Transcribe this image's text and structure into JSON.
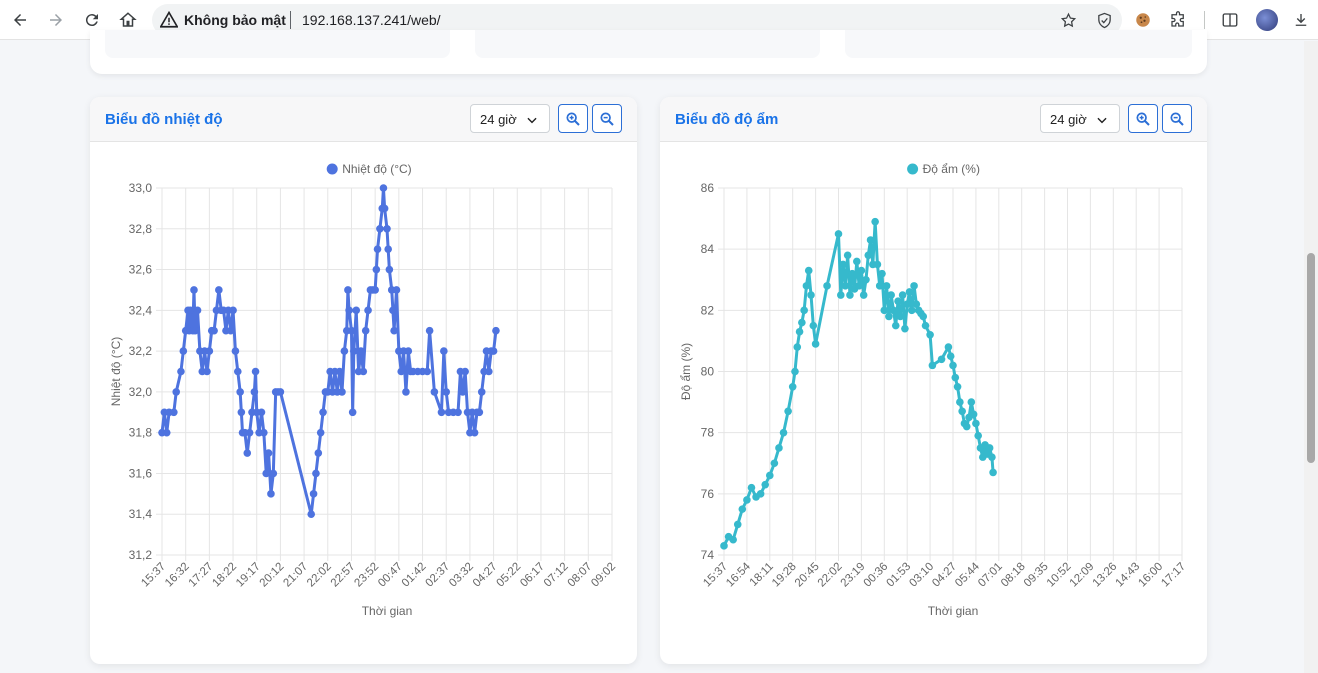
{
  "browser": {
    "security_label": "Không bảo mật",
    "url": "192.168.137.241/web/"
  },
  "cards": [
    {
      "title": "Biểu đồ nhiệt độ",
      "range_label": "24 giờ",
      "color": "#4e73df"
    },
    {
      "title": "Biểu đồ độ ẩm",
      "range_label": "24 giờ",
      "color": "#36b9cc"
    }
  ],
  "chart_data": [
    {
      "type": "line",
      "legend": "Nhiệt độ (°C)",
      "xlabel": "Thời gian",
      "ylabel": "Nhiệt độ (°C)",
      "ylim": [
        31.2,
        33.0
      ],
      "yticks": [
        "31,2",
        "31,4",
        "31,6",
        "31,8",
        "32,0",
        "32,2",
        "32,4",
        "32,6",
        "32,8",
        "33,0"
      ],
      "xticks": [
        "15:37",
        "16:32",
        "17:27",
        "18:22",
        "19:17",
        "20:12",
        "21:07",
        "22:02",
        "22:57",
        "23:52",
        "00:47",
        "01:42",
        "02:37",
        "03:32",
        "04:27",
        "05:22",
        "06:17",
        "07:12",
        "08:07",
        "09:02"
      ],
      "grid": true,
      "legend_position": "top",
      "series": [
        {
          "name": "Nhiệt độ (°C)",
          "color": "#4e73df",
          "points": [
            [
              0.0,
              31.8
            ],
            [
              0.1,
              31.9
            ],
            [
              0.2,
              31.8
            ],
            [
              0.3,
              31.9
            ],
            [
              0.5,
              31.9
            ],
            [
              0.6,
              32.0
            ],
            [
              0.8,
              32.1
            ],
            [
              0.9,
              32.2
            ],
            [
              1.0,
              32.3
            ],
            [
              1.1,
              32.4
            ],
            [
              1.15,
              32.3
            ],
            [
              1.2,
              32.4
            ],
            [
              1.3,
              32.3
            ],
            [
              1.35,
              32.5
            ],
            [
              1.4,
              32.3
            ],
            [
              1.5,
              32.4
            ],
            [
              1.6,
              32.2
            ],
            [
              1.7,
              32.1
            ],
            [
              1.8,
              32.2
            ],
            [
              1.9,
              32.1
            ],
            [
              2.0,
              32.2
            ],
            [
              2.1,
              32.3
            ],
            [
              2.2,
              32.3
            ],
            [
              2.3,
              32.4
            ],
            [
              2.4,
              32.5
            ],
            [
              2.5,
              32.4
            ],
            [
              2.6,
              32.4
            ],
            [
              2.7,
              32.3
            ],
            [
              2.8,
              32.4
            ],
            [
              2.9,
              32.3
            ],
            [
              3.0,
              32.4
            ],
            [
              3.1,
              32.2
            ],
            [
              3.2,
              32.1
            ],
            [
              3.3,
              32.0
            ],
            [
              3.35,
              31.9
            ],
            [
              3.4,
              31.8
            ],
            [
              3.5,
              31.8
            ],
            [
              3.6,
              31.7
            ],
            [
              3.7,
              31.8
            ],
            [
              3.8,
              31.9
            ],
            [
              3.9,
              32.0
            ],
            [
              3.95,
              32.1
            ],
            [
              4.0,
              31.9
            ],
            [
              4.1,
              31.8
            ],
            [
              4.2,
              31.9
            ],
            [
              4.3,
              31.8
            ],
            [
              4.4,
              31.6
            ],
            [
              4.5,
              31.7
            ],
            [
              4.6,
              31.5
            ],
            [
              4.7,
              31.6
            ],
            [
              4.8,
              32.0
            ],
            [
              4.9,
              32.0
            ],
            [
              5.0,
              32.0
            ],
            [
              6.3,
              31.4
            ],
            [
              6.4,
              31.5
            ],
            [
              6.5,
              31.6
            ],
            [
              6.6,
              31.7
            ],
            [
              6.7,
              31.8
            ],
            [
              6.8,
              31.9
            ],
            [
              6.9,
              32.0
            ],
            [
              7.0,
              32.0
            ],
            [
              7.1,
              32.1
            ],
            [
              7.2,
              32.0
            ],
            [
              7.3,
              32.1
            ],
            [
              7.4,
              32.0
            ],
            [
              7.5,
              32.1
            ],
            [
              7.6,
              32.0
            ],
            [
              7.7,
              32.2
            ],
            [
              7.8,
              32.3
            ],
            [
              7.85,
              32.5
            ],
            [
              7.9,
              32.4
            ],
            [
              8.0,
              32.3
            ],
            [
              8.05,
              31.9
            ],
            [
              8.1,
              32.2
            ],
            [
              8.2,
              32.4
            ],
            [
              8.3,
              32.1
            ],
            [
              8.4,
              32.2
            ],
            [
              8.5,
              32.1
            ],
            [
              8.6,
              32.3
            ],
            [
              8.7,
              32.4
            ],
            [
              8.8,
              32.5
            ],
            [
              8.9,
              32.5
            ],
            [
              9.0,
              32.5
            ],
            [
              9.05,
              32.6
            ],
            [
              9.1,
              32.7
            ],
            [
              9.2,
              32.8
            ],
            [
              9.3,
              32.9
            ],
            [
              9.35,
              33.0
            ],
            [
              9.4,
              32.9
            ],
            [
              9.5,
              32.8
            ],
            [
              9.55,
              32.7
            ],
            [
              9.6,
              32.6
            ],
            [
              9.7,
              32.5
            ],
            [
              9.75,
              32.4
            ],
            [
              9.8,
              32.3
            ],
            [
              9.9,
              32.5
            ],
            [
              10.0,
              32.2
            ],
            [
              10.1,
              32.1
            ],
            [
              10.2,
              32.2
            ],
            [
              10.3,
              32.0
            ],
            [
              10.4,
              32.2
            ],
            [
              10.5,
              32.1
            ],
            [
              10.6,
              32.1
            ],
            [
              10.8,
              32.1
            ],
            [
              11.0,
              32.1
            ],
            [
              11.2,
              32.1
            ],
            [
              11.3,
              32.3
            ],
            [
              11.5,
              32.0
            ],
            [
              11.8,
              31.9
            ],
            [
              11.9,
              32.2
            ],
            [
              12.0,
              32.0
            ],
            [
              12.1,
              31.9
            ],
            [
              12.3,
              31.9
            ],
            [
              12.5,
              31.9
            ],
            [
              12.6,
              32.1
            ],
            [
              12.7,
              32.0
            ],
            [
              12.8,
              32.1
            ],
            [
              12.9,
              31.9
            ],
            [
              13.0,
              31.8
            ],
            [
              13.1,
              31.9
            ],
            [
              13.2,
              31.8
            ],
            [
              13.3,
              31.9
            ],
            [
              13.4,
              31.9
            ],
            [
              13.5,
              32.0
            ],
            [
              13.6,
              32.1
            ],
            [
              13.7,
              32.2
            ],
            [
              13.8,
              32.1
            ],
            [
              13.9,
              32.2
            ],
            [
              14.0,
              32.2
            ],
            [
              14.1,
              32.3
            ]
          ]
        }
      ]
    },
    {
      "type": "line",
      "legend": "Độ ẩm (%)",
      "xlabel": "Thời gian",
      "ylabel": "Độ ẩm (%)",
      "ylim": [
        74,
        86
      ],
      "yticks": [
        "74",
        "76",
        "78",
        "80",
        "82",
        "84",
        "86"
      ],
      "xticks": [
        "15:37",
        "16:54",
        "18:11",
        "19:28",
        "20:45",
        "22:02",
        "23:19",
        "00:36",
        "01:53",
        "03:10",
        "04:27",
        "05:44",
        "07:01",
        "08:18",
        "09:35",
        "10:52",
        "12:09",
        "13:26",
        "14:43",
        "16:00",
        "17:17"
      ],
      "grid": true,
      "legend_position": "top",
      "series": [
        {
          "name": "Độ ẩm (%)",
          "color": "#36b9cc",
          "points": [
            [
              0.0,
              74.3
            ],
            [
              0.2,
              74.6
            ],
            [
              0.4,
              74.5
            ],
            [
              0.6,
              75.0
            ],
            [
              0.8,
              75.5
            ],
            [
              1.0,
              75.8
            ],
            [
              1.2,
              76.2
            ],
            [
              1.4,
              75.9
            ],
            [
              1.6,
              76.0
            ],
            [
              1.8,
              76.3
            ],
            [
              2.0,
              76.6
            ],
            [
              2.2,
              77.0
            ],
            [
              2.4,
              77.5
            ],
            [
              2.6,
              78.0
            ],
            [
              2.8,
              78.7
            ],
            [
              3.0,
              79.5
            ],
            [
              3.1,
              80.0
            ],
            [
              3.2,
              80.8
            ],
            [
              3.3,
              81.3
            ],
            [
              3.4,
              81.6
            ],
            [
              3.5,
              82.0
            ],
            [
              3.6,
              82.8
            ],
            [
              3.7,
              83.3
            ],
            [
              3.8,
              82.5
            ],
            [
              3.9,
              81.5
            ],
            [
              4.0,
              80.9
            ],
            [
              4.5,
              82.8
            ],
            [
              5.0,
              84.5
            ],
            [
              5.1,
              82.5
            ],
            [
              5.2,
              83.5
            ],
            [
              5.3,
              82.8
            ],
            [
              5.4,
              83.8
            ],
            [
              5.5,
              82.5
            ],
            [
              5.6,
              83.2
            ],
            [
              5.7,
              82.7
            ],
            [
              5.8,
              83.6
            ],
            [
              5.9,
              82.8
            ],
            [
              6.0,
              83.3
            ],
            [
              6.1,
              82.5
            ],
            [
              6.2,
              83.0
            ],
            [
              6.3,
              83.8
            ],
            [
              6.4,
              84.3
            ],
            [
              6.5,
              83.5
            ],
            [
              6.6,
              84.9
            ],
            [
              6.7,
              83.5
            ],
            [
              6.8,
              82.8
            ],
            [
              6.9,
              83.2
            ],
            [
              7.0,
              82.0
            ],
            [
              7.1,
              82.8
            ],
            [
              7.2,
              81.8
            ],
            [
              7.3,
              82.5
            ],
            [
              7.4,
              82.0
            ],
            [
              7.5,
              81.5
            ],
            [
              7.6,
              82.3
            ],
            [
              7.7,
              81.8
            ],
            [
              7.8,
              82.5
            ],
            [
              7.9,
              81.4
            ],
            [
              8.0,
              82.2
            ],
            [
              8.1,
              82.6
            ],
            [
              8.2,
              82.0
            ],
            [
              8.3,
              82.8
            ],
            [
              8.4,
              82.2
            ],
            [
              8.5,
              82.0
            ],
            [
              8.6,
              81.9
            ],
            [
              8.7,
              81.8
            ],
            [
              8.8,
              81.5
            ],
            [
              9.0,
              81.2
            ],
            [
              9.1,
              80.2
            ],
            [
              9.5,
              80.4
            ],
            [
              9.8,
              80.8
            ],
            [
              9.9,
              80.5
            ],
            [
              10.0,
              80.2
            ],
            [
              10.1,
              79.8
            ],
            [
              10.2,
              79.5
            ],
            [
              10.3,
              79.0
            ],
            [
              10.4,
              78.7
            ],
            [
              10.5,
              78.3
            ],
            [
              10.6,
              78.2
            ],
            [
              10.7,
              78.5
            ],
            [
              10.8,
              79.0
            ],
            [
              10.9,
              78.6
            ],
            [
              11.0,
              78.3
            ],
            [
              11.1,
              77.9
            ],
            [
              11.2,
              77.5
            ],
            [
              11.3,
              77.2
            ],
            [
              11.4,
              77.6
            ],
            [
              11.5,
              77.3
            ],
            [
              11.6,
              77.5
            ],
            [
              11.7,
              77.2
            ],
            [
              11.75,
              76.7
            ]
          ]
        }
      ]
    }
  ]
}
